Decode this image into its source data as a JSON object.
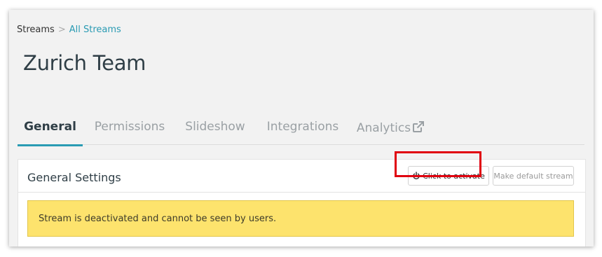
{
  "breadcrumb": {
    "root": "Streams",
    "separator": ">",
    "current": "All Streams"
  },
  "page": {
    "title": "Zurich Team"
  },
  "tabs": [
    {
      "label": "General",
      "active": true
    },
    {
      "label": "Permissions",
      "active": false
    },
    {
      "label": "Slideshow",
      "active": false
    },
    {
      "label": "Integrations",
      "active": false
    },
    {
      "label": "Analytics",
      "active": false,
      "icon": "external-link-icon"
    }
  ],
  "panel": {
    "title": "General Settings",
    "activate_button": {
      "label": "Click to activate",
      "icon": "power-icon"
    },
    "default_button": {
      "label": "Make default stream"
    },
    "alert": "Stream is deactivated and cannot be seen by users."
  },
  "colors": {
    "accent": "#2a9bb3",
    "alert_background": "#fde36d",
    "highlight": "#e0000f"
  }
}
